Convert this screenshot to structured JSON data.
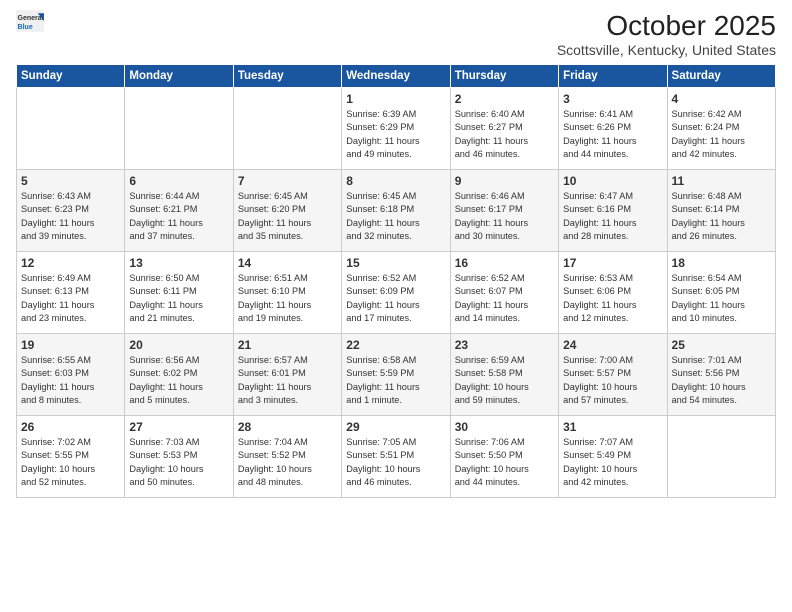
{
  "header": {
    "logo_general": "General",
    "logo_blue": "Blue",
    "month": "October 2025",
    "location": "Scottsville, Kentucky, United States"
  },
  "days_of_week": [
    "Sunday",
    "Monday",
    "Tuesday",
    "Wednesday",
    "Thursday",
    "Friday",
    "Saturday"
  ],
  "weeks": [
    [
      {
        "day": "",
        "text": ""
      },
      {
        "day": "",
        "text": ""
      },
      {
        "day": "",
        "text": ""
      },
      {
        "day": "1",
        "text": "Sunrise: 6:39 AM\nSunset: 6:29 PM\nDaylight: 11 hours\nand 49 minutes."
      },
      {
        "day": "2",
        "text": "Sunrise: 6:40 AM\nSunset: 6:27 PM\nDaylight: 11 hours\nand 46 minutes."
      },
      {
        "day": "3",
        "text": "Sunrise: 6:41 AM\nSunset: 6:26 PM\nDaylight: 11 hours\nand 44 minutes."
      },
      {
        "day": "4",
        "text": "Sunrise: 6:42 AM\nSunset: 6:24 PM\nDaylight: 11 hours\nand 42 minutes."
      }
    ],
    [
      {
        "day": "5",
        "text": "Sunrise: 6:43 AM\nSunset: 6:23 PM\nDaylight: 11 hours\nand 39 minutes."
      },
      {
        "day": "6",
        "text": "Sunrise: 6:44 AM\nSunset: 6:21 PM\nDaylight: 11 hours\nand 37 minutes."
      },
      {
        "day": "7",
        "text": "Sunrise: 6:45 AM\nSunset: 6:20 PM\nDaylight: 11 hours\nand 35 minutes."
      },
      {
        "day": "8",
        "text": "Sunrise: 6:45 AM\nSunset: 6:18 PM\nDaylight: 11 hours\nand 32 minutes."
      },
      {
        "day": "9",
        "text": "Sunrise: 6:46 AM\nSunset: 6:17 PM\nDaylight: 11 hours\nand 30 minutes."
      },
      {
        "day": "10",
        "text": "Sunrise: 6:47 AM\nSunset: 6:16 PM\nDaylight: 11 hours\nand 28 minutes."
      },
      {
        "day": "11",
        "text": "Sunrise: 6:48 AM\nSunset: 6:14 PM\nDaylight: 11 hours\nand 26 minutes."
      }
    ],
    [
      {
        "day": "12",
        "text": "Sunrise: 6:49 AM\nSunset: 6:13 PM\nDaylight: 11 hours\nand 23 minutes."
      },
      {
        "day": "13",
        "text": "Sunrise: 6:50 AM\nSunset: 6:11 PM\nDaylight: 11 hours\nand 21 minutes."
      },
      {
        "day": "14",
        "text": "Sunrise: 6:51 AM\nSunset: 6:10 PM\nDaylight: 11 hours\nand 19 minutes."
      },
      {
        "day": "15",
        "text": "Sunrise: 6:52 AM\nSunset: 6:09 PM\nDaylight: 11 hours\nand 17 minutes."
      },
      {
        "day": "16",
        "text": "Sunrise: 6:52 AM\nSunset: 6:07 PM\nDaylight: 11 hours\nand 14 minutes."
      },
      {
        "day": "17",
        "text": "Sunrise: 6:53 AM\nSunset: 6:06 PM\nDaylight: 11 hours\nand 12 minutes."
      },
      {
        "day": "18",
        "text": "Sunrise: 6:54 AM\nSunset: 6:05 PM\nDaylight: 11 hours\nand 10 minutes."
      }
    ],
    [
      {
        "day": "19",
        "text": "Sunrise: 6:55 AM\nSunset: 6:03 PM\nDaylight: 11 hours\nand 8 minutes."
      },
      {
        "day": "20",
        "text": "Sunrise: 6:56 AM\nSunset: 6:02 PM\nDaylight: 11 hours\nand 5 minutes."
      },
      {
        "day": "21",
        "text": "Sunrise: 6:57 AM\nSunset: 6:01 PM\nDaylight: 11 hours\nand 3 minutes."
      },
      {
        "day": "22",
        "text": "Sunrise: 6:58 AM\nSunset: 5:59 PM\nDaylight: 11 hours\nand 1 minute."
      },
      {
        "day": "23",
        "text": "Sunrise: 6:59 AM\nSunset: 5:58 PM\nDaylight: 10 hours\nand 59 minutes."
      },
      {
        "day": "24",
        "text": "Sunrise: 7:00 AM\nSunset: 5:57 PM\nDaylight: 10 hours\nand 57 minutes."
      },
      {
        "day": "25",
        "text": "Sunrise: 7:01 AM\nSunset: 5:56 PM\nDaylight: 10 hours\nand 54 minutes."
      }
    ],
    [
      {
        "day": "26",
        "text": "Sunrise: 7:02 AM\nSunset: 5:55 PM\nDaylight: 10 hours\nand 52 minutes."
      },
      {
        "day": "27",
        "text": "Sunrise: 7:03 AM\nSunset: 5:53 PM\nDaylight: 10 hours\nand 50 minutes."
      },
      {
        "day": "28",
        "text": "Sunrise: 7:04 AM\nSunset: 5:52 PM\nDaylight: 10 hours\nand 48 minutes."
      },
      {
        "day": "29",
        "text": "Sunrise: 7:05 AM\nSunset: 5:51 PM\nDaylight: 10 hours\nand 46 minutes."
      },
      {
        "day": "30",
        "text": "Sunrise: 7:06 AM\nSunset: 5:50 PM\nDaylight: 10 hours\nand 44 minutes."
      },
      {
        "day": "31",
        "text": "Sunrise: 7:07 AM\nSunset: 5:49 PM\nDaylight: 10 hours\nand 42 minutes."
      },
      {
        "day": "",
        "text": ""
      }
    ]
  ]
}
